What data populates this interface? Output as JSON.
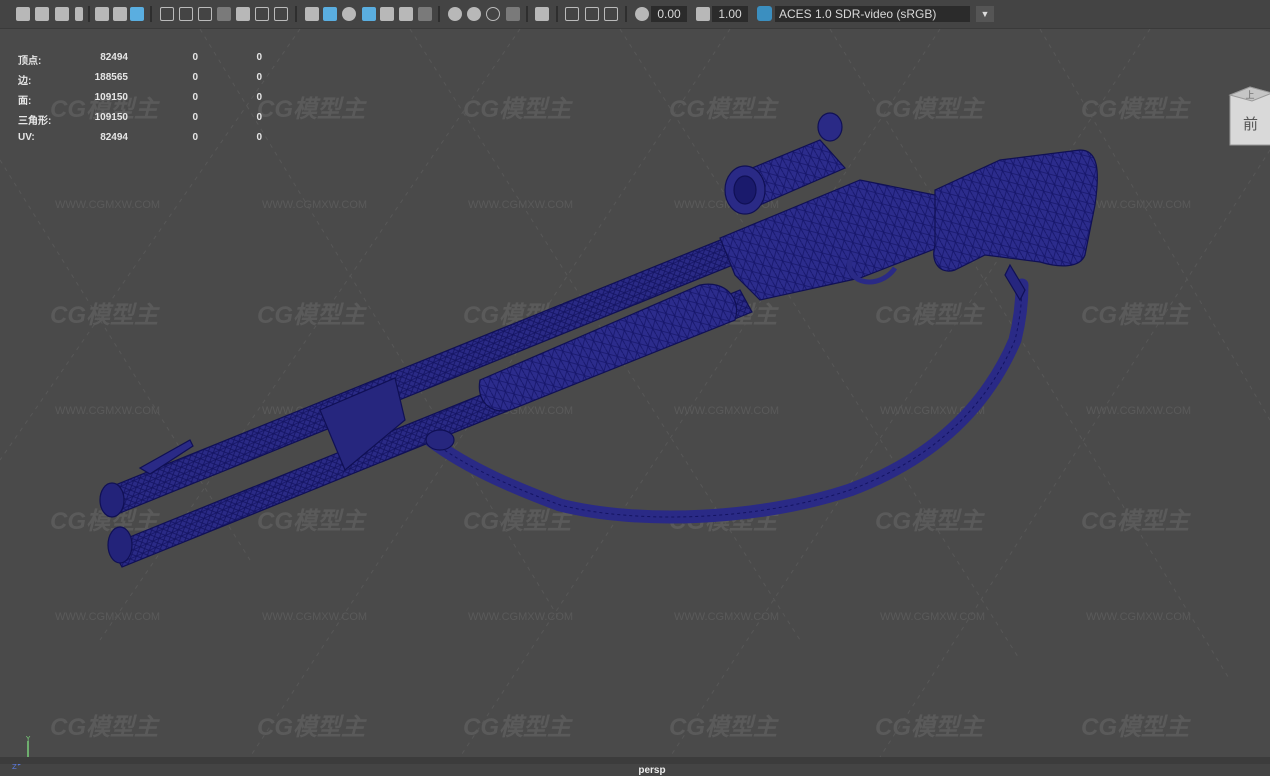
{
  "toolbar": {
    "value_a": "0.00",
    "value_b": "1.00",
    "colorspace": "ACES 1.0 SDR-video (sRGB)",
    "colors": {
      "active": "#5aaee0",
      "bg": "#444444"
    }
  },
  "hud": {
    "rows": [
      {
        "label": "顶点:",
        "v1": "82494",
        "v2": "0",
        "v3": "0"
      },
      {
        "label": "边:",
        "v1": "188565",
        "v2": "0",
        "v3": "0"
      },
      {
        "label": "面:",
        "v1": "109150",
        "v2": "0",
        "v3": "0"
      },
      {
        "label": "三角形:",
        "v1": "109150",
        "v2": "0",
        "v3": "0"
      },
      {
        "label": "UV:",
        "v1": "82494",
        "v2": "0",
        "v3": "0"
      }
    ]
  },
  "viewcube": {
    "top": "上",
    "front": "前"
  },
  "watermark": {
    "logo": "CG模型主",
    "url": "WWW.CGMXW.COM"
  },
  "viewport": {
    "camera": "persp",
    "wire_color": "#1a1a7a",
    "bg": "#4a4a4a"
  },
  "axis": {
    "y": "Y",
    "x": "X",
    "z": "Z"
  }
}
